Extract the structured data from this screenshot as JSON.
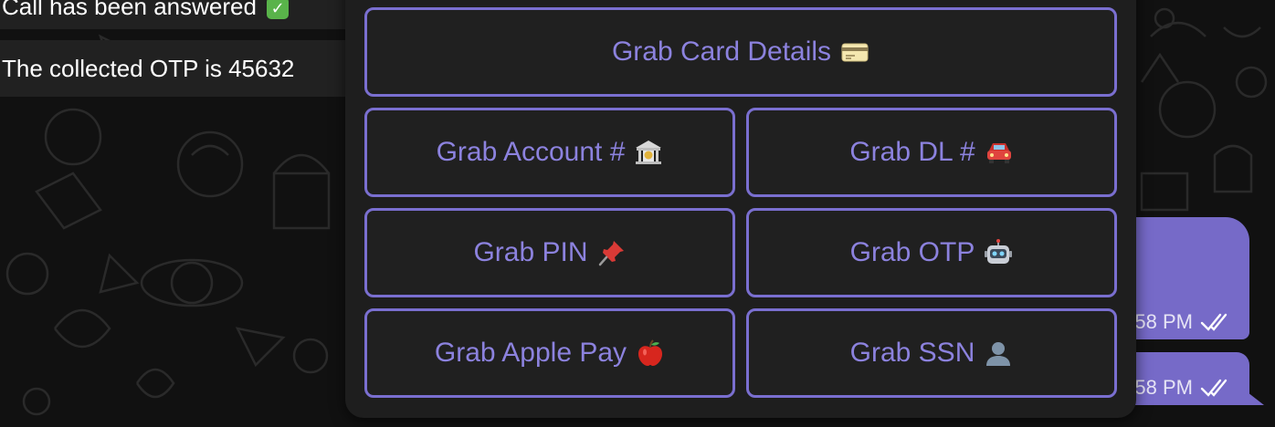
{
  "messages_in": [
    {
      "text": "Call has been answered",
      "emoji": "check-mark-icon"
    },
    {
      "text": "The collected OTP is 45632"
    }
  ],
  "messages_out": [
    {
      "time": "58 PM",
      "status": "read"
    },
    {
      "time": "58 PM",
      "status": "read"
    }
  ],
  "keyboard": {
    "buttons": [
      {
        "label": "Grab Card Details",
        "icon": "credit-card-icon"
      },
      {
        "label": "Grab Account #",
        "icon": "bank-icon"
      },
      {
        "label": "Grab DL #",
        "icon": "car-icon"
      },
      {
        "label": "Grab PIN",
        "icon": "pushpin-icon"
      },
      {
        "label": "Grab OTP",
        "icon": "robot-icon"
      },
      {
        "label": "Grab Apple Pay",
        "icon": "apple-icon"
      },
      {
        "label": "Grab SSN",
        "icon": "person-silhouette-icon"
      }
    ]
  },
  "colors": {
    "accent": "#766ac8",
    "button_border": "#7a6fd0",
    "button_text": "#8c82de",
    "panel_bg": "#1e1e1e",
    "chat_bg": "#111111",
    "incoming_bubble": "#212121",
    "check_emoji": "#59b34a"
  }
}
